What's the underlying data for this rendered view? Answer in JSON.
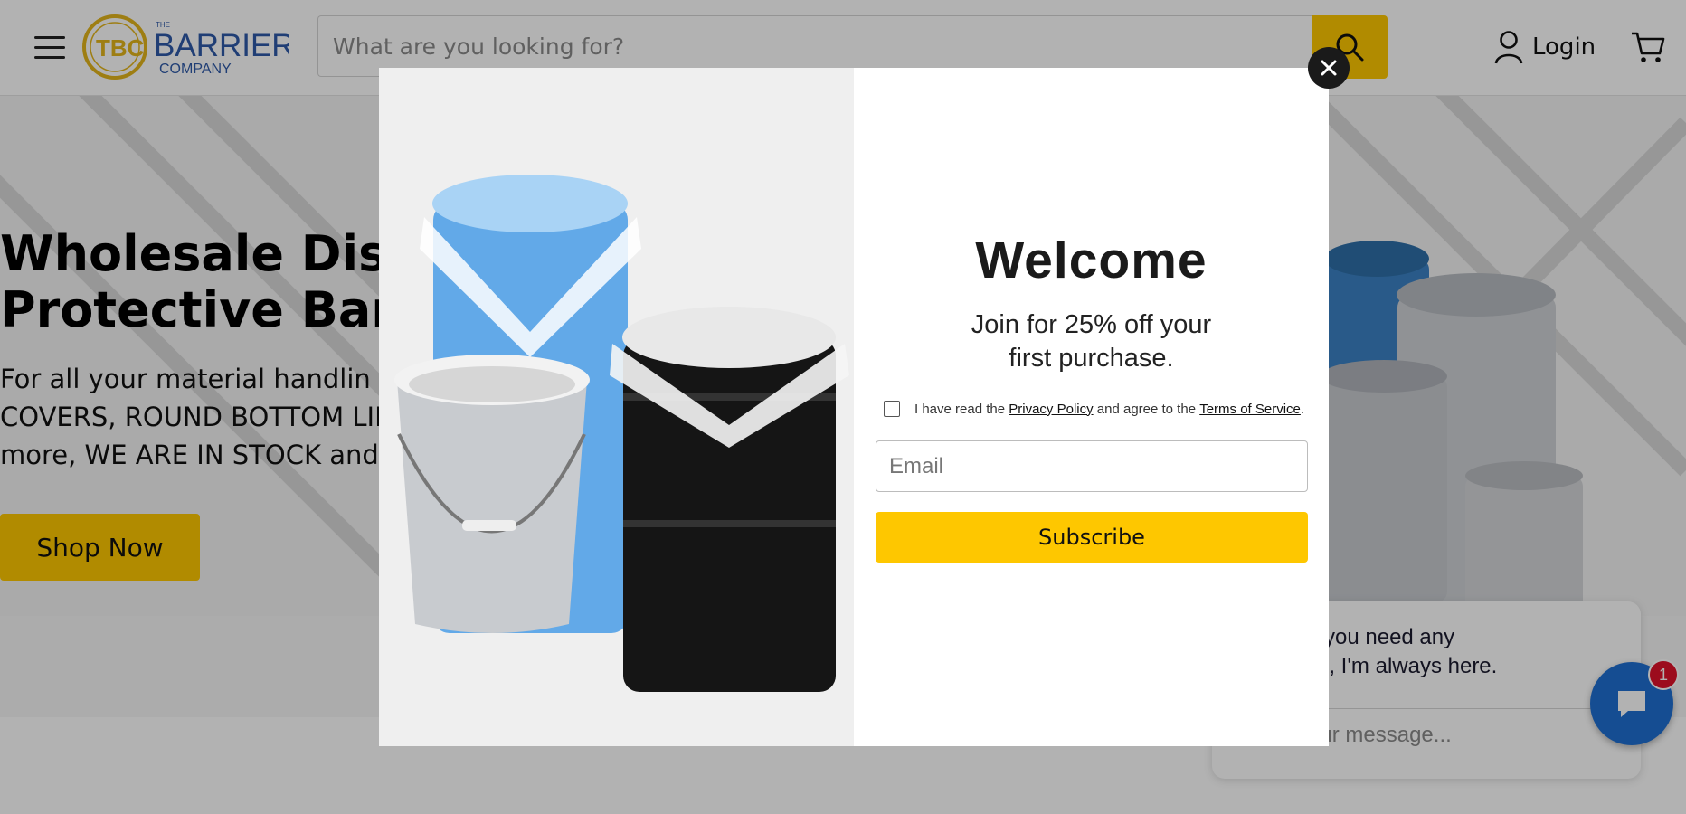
{
  "header": {
    "logo_small": "THE",
    "logo_word": "BARRIER",
    "logo_sub": "COMPANY",
    "search_placeholder": "What are you looking for?",
    "login_label": "Login"
  },
  "hero": {
    "title": "Wholesale Distrib\nProtective Barrier",
    "subtitle": "For all your material handlin\nCOVERS, ROUND BOTTOM LIN\nmore, WE ARE IN STOCK and",
    "cta_label": "Shop Now"
  },
  "chat": {
    "message": "If you need any\nce, I'm always here.",
    "input_placeholder": "Enter your message...",
    "badge_count": "1"
  },
  "modal": {
    "title": "Welcome",
    "subtitle": "Join for 25% off your\nfirst purchase.",
    "consent_prefix": "I have read the ",
    "privacy_link": "Privacy Policy",
    "consent_mid": " and agree to the ",
    "terms_link": "Terms of Service",
    "consent_suffix": ".",
    "email_placeholder": "Email",
    "subscribe_label": "Subscribe"
  },
  "colors": {
    "accent": "#fec700",
    "logo_blue": "#2f5aa8",
    "logo_gold": "#e3b51c",
    "chat_blue": "#1f6fd2",
    "badge_red": "#e0122a"
  },
  "icons": {
    "menu": "hamburger-icon",
    "search": "search-icon",
    "user": "user-icon",
    "cart": "cart-icon",
    "close": "close-icon",
    "chat": "chat-bubble-icon"
  }
}
